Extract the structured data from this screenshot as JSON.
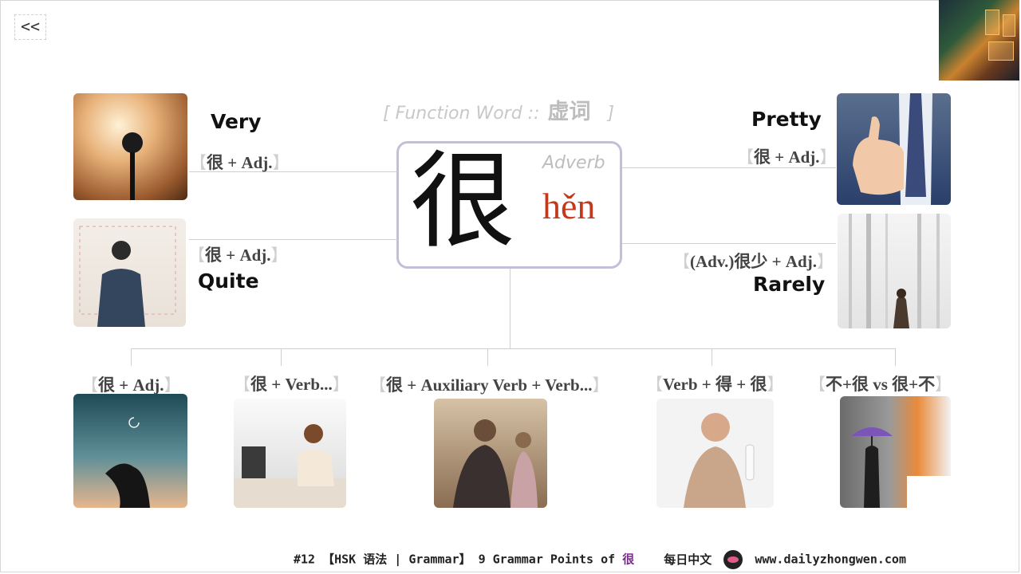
{
  "nav": {
    "back_label": "<<"
  },
  "header": {
    "function_word_prefix": "[ Function Word ::",
    "function_word_cn": "虚词",
    "function_word_suffix": "]"
  },
  "center": {
    "hanzi": "很",
    "part_of_speech": "Adverb",
    "pinyin": "hěn"
  },
  "meanings": [
    {
      "title": "Very",
      "pattern": "很 + Adj."
    },
    {
      "title": "Quite",
      "pattern": "很 + Adj."
    },
    {
      "title": "Pretty",
      "pattern": "很 + Adj."
    },
    {
      "title": "Rarely",
      "pattern": "(Adv.)很少 + Adj."
    }
  ],
  "bottom_patterns": [
    {
      "pattern": "很 + Adj."
    },
    {
      "pattern": "很 + Verb..."
    },
    {
      "pattern": "很 + Auxiliary Verb + Verb..."
    },
    {
      "pattern": "Verb + 得 + 很"
    },
    {
      "pattern": "不+很 vs 很+不"
    }
  ],
  "bracket_open": "【",
  "bracket_close": "】",
  "footer": {
    "text": "#12 【HSK 语法 | Grammar】 9 Grammar Points of ",
    "accent": "很",
    "site_cn": "每日中文",
    "site_url": "www.dailyzhongwen.com"
  },
  "colors": {
    "pinyin": "#c2391c",
    "box_border": "#c4bedb",
    "accent": "#7a2a8a"
  }
}
